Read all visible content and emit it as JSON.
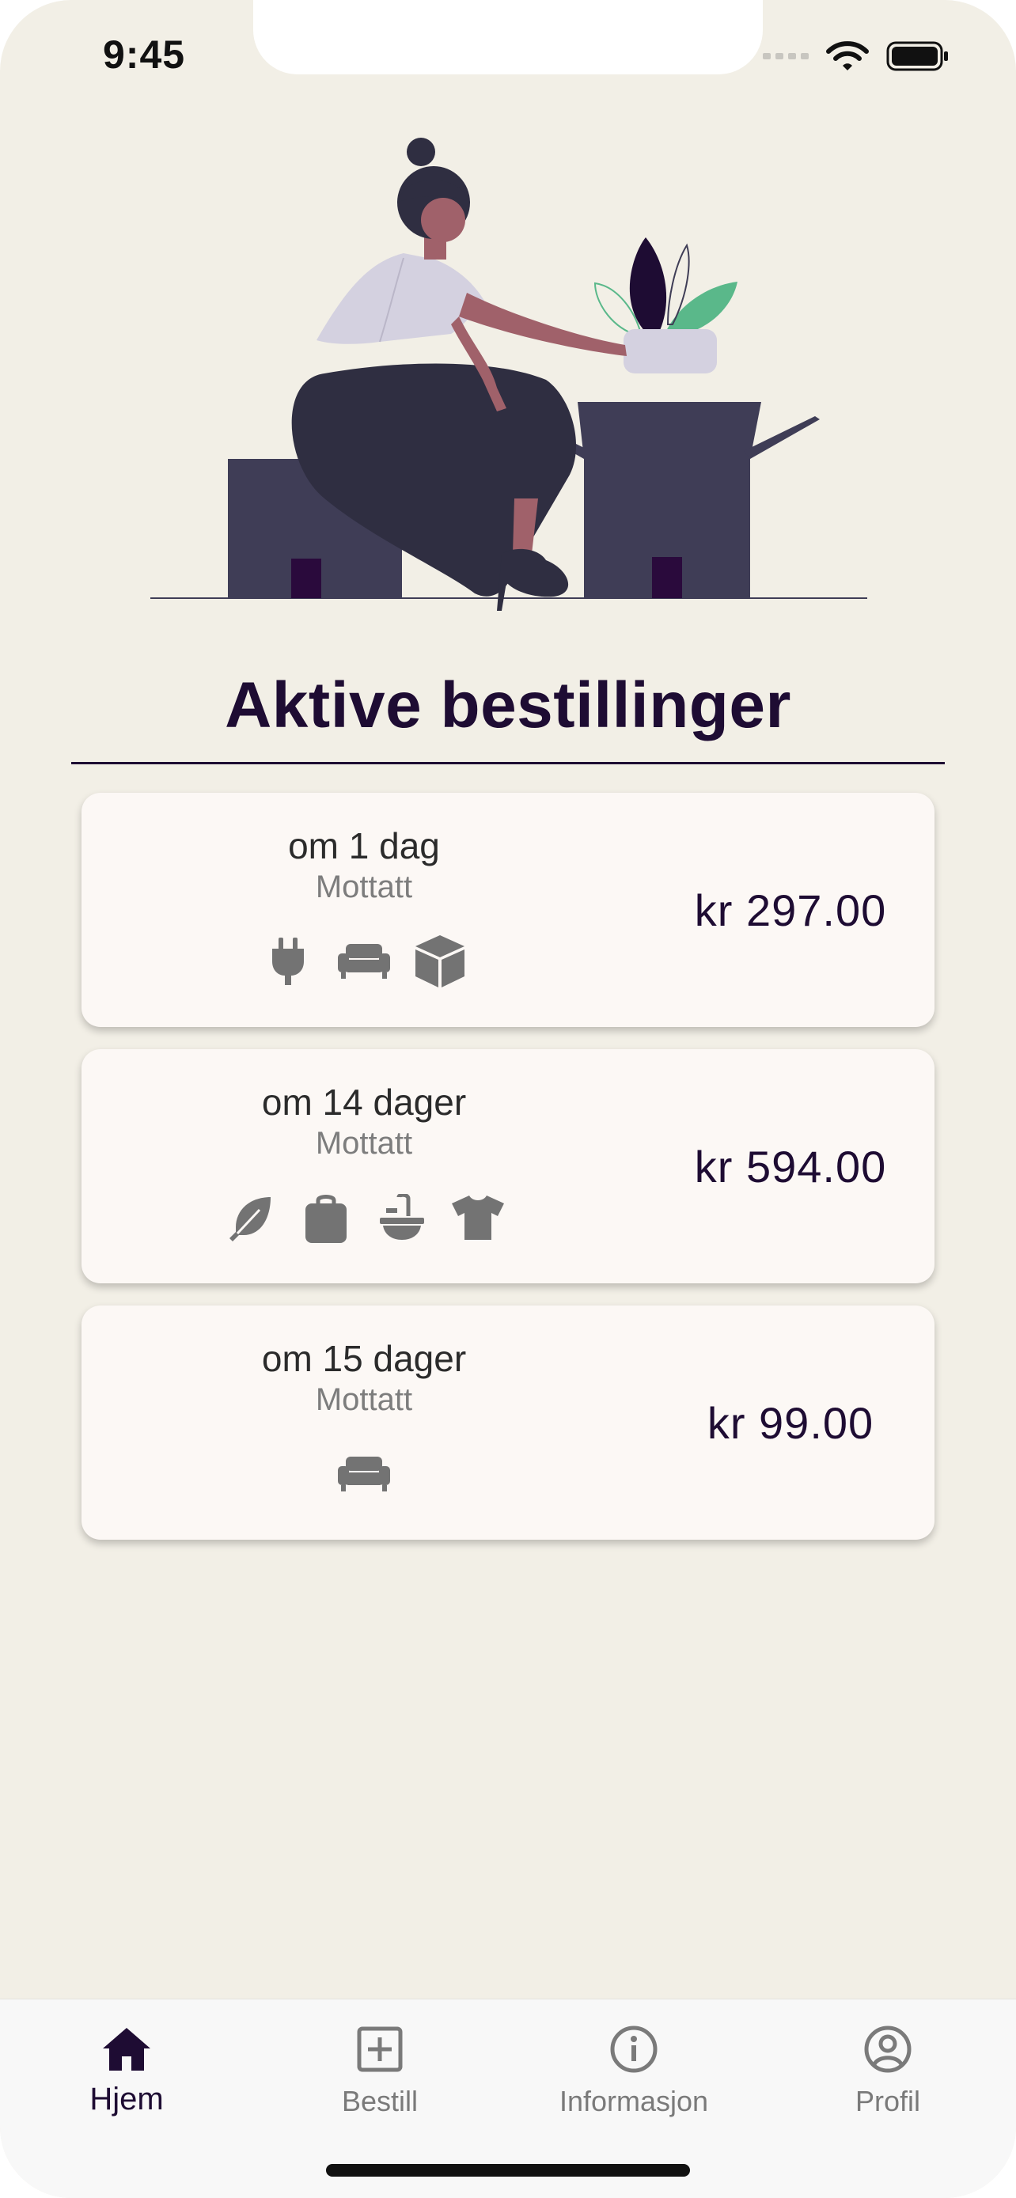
{
  "status_bar": {
    "time": "9:45"
  },
  "main": {
    "title": "Aktive bestillinger",
    "orders": [
      {
        "eta": "om 1 dag",
        "status": "Mottatt",
        "price": "kr 297.00",
        "icons": [
          "plug-icon",
          "sofa-icon",
          "box-icon"
        ]
      },
      {
        "eta": "om 14 dager",
        "status": "Mottatt",
        "price": "kr 594.00",
        "icons": [
          "feather-icon",
          "bag-icon",
          "sink-icon",
          "tshirt-icon"
        ]
      },
      {
        "eta": "om 15 dager",
        "status": "Mottatt",
        "price": "kr 99.00",
        "icons": [
          "sofa-icon"
        ]
      }
    ]
  },
  "tabbar": {
    "tabs": [
      {
        "label": "Hjem",
        "icon": "home-icon",
        "active": true
      },
      {
        "label": "Bestill",
        "icon": "plus-square-icon",
        "active": false
      },
      {
        "label": "Informasjon",
        "icon": "info-icon",
        "active": false
      },
      {
        "label": "Profil",
        "icon": "profile-icon",
        "active": false
      }
    ]
  },
  "colors": {
    "background": "#f2efe6",
    "card": "#fcf8f5",
    "accent": "#1e0c33",
    "icon_gray": "#737373",
    "leaf_green": "#5ab88a"
  }
}
